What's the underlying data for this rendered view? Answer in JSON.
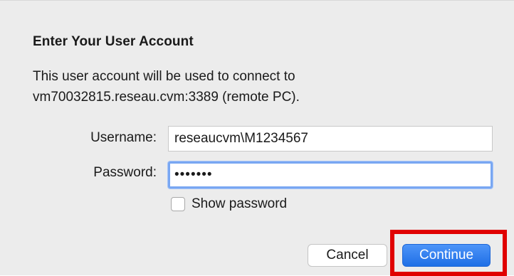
{
  "dialog": {
    "title": "Enter Your User Account",
    "description_line1": "This user account will be used to connect to",
    "description_line2": "vm70032815.reseau.cvm:3389 (remote PC)."
  },
  "form": {
    "username_label": "Username:",
    "username_value": "reseaucvm\\M1234567",
    "password_label": "Password:",
    "password_value": "•••••••",
    "show_password_label": "Show password",
    "show_password_checked": false
  },
  "buttons": {
    "cancel_label": "Cancel",
    "continue_label": "Continue"
  },
  "colors": {
    "accent": "#1f6fe6",
    "highlight": "#e00000",
    "background": "#ececec"
  }
}
